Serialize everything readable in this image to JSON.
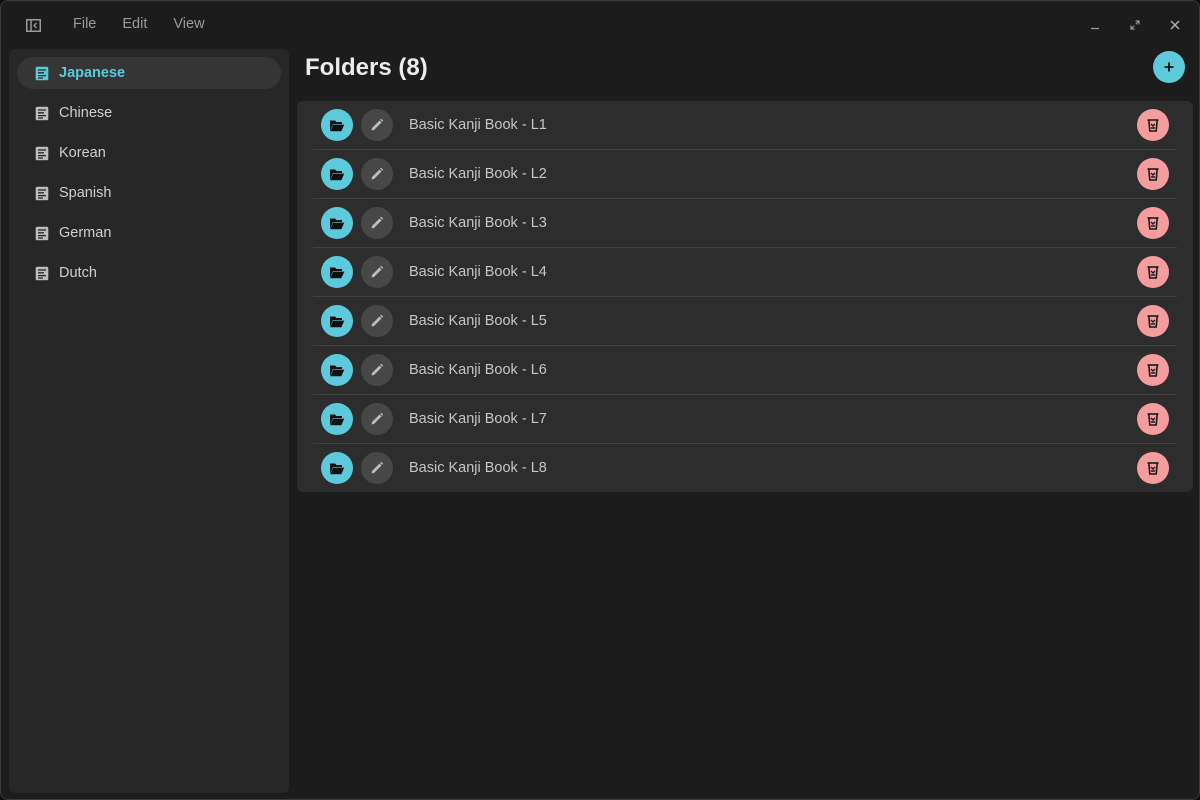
{
  "menu": {
    "file": "File",
    "edit": "Edit",
    "view": "View"
  },
  "sidebar": {
    "items": [
      {
        "label": "Japanese",
        "active": true
      },
      {
        "label": "Chinese"
      },
      {
        "label": "Korean"
      },
      {
        "label": "Spanish"
      },
      {
        "label": "German"
      },
      {
        "label": "Dutch"
      }
    ]
  },
  "main": {
    "title": "Folders (8)",
    "folders": [
      {
        "name": "Basic Kanji Book - L1"
      },
      {
        "name": "Basic Kanji Book - L2"
      },
      {
        "name": "Basic Kanji Book - L3"
      },
      {
        "name": "Basic Kanji Book - L4"
      },
      {
        "name": "Basic Kanji Book - L5"
      },
      {
        "name": "Basic Kanji Book - L6"
      },
      {
        "name": "Basic Kanji Book - L7"
      },
      {
        "name": "Basic Kanji Book - L8"
      }
    ]
  },
  "icons": {
    "sidebar_toggle": "sidebar-toggle-icon",
    "document": "document-icon",
    "add": "plus-icon",
    "open": "folder-open-icon",
    "edit": "pencil-icon",
    "delete": "trash-icon",
    "minimize": "minimize-icon",
    "maximize": "maximize-icon",
    "close": "close-icon"
  },
  "colors": {
    "accent": "#5ccadb",
    "danger": "#f59c9c",
    "background": "#1c1c1c",
    "panel": "#2d2d2d",
    "sidebar": "#272727"
  }
}
